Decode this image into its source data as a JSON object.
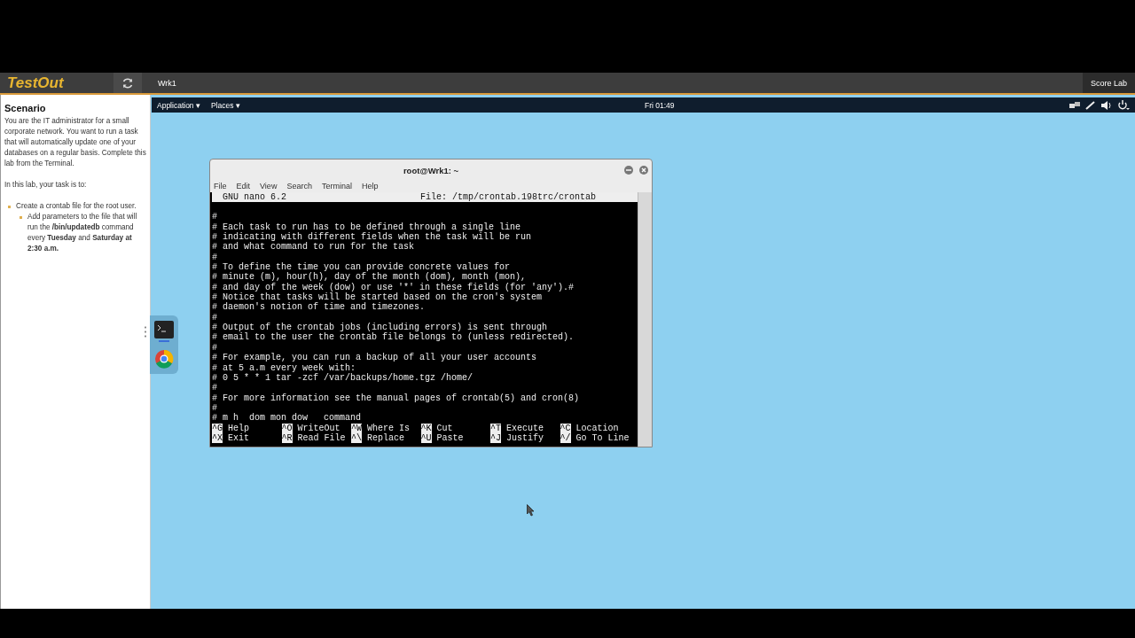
{
  "header": {
    "logo": "TestOut",
    "tab": "Wrk1",
    "score_button": "Score Lab"
  },
  "scenario": {
    "title": "Scenario",
    "paragraphs": [
      "You are the IT administrator for a small corporate network. You want to run a task that will automatically update one of your databases on a regular basis. Complete this lab from the Terminal.",
      "In this lab, your task is to:"
    ],
    "tasks": [
      {
        "text": "Create a crontab file for the root user.",
        "children": [
          {
            "text": "Add parameters to the file that will run the **/bin/updatedb** command every **Tuesday** and **Saturday at 2:30 a.m.**"
          }
        ]
      }
    ]
  },
  "top_panel": {
    "menus": [
      "Application ▾",
      "Places ▾"
    ],
    "clock": "Fri 01:49"
  },
  "terminal": {
    "title": "root@Wrk1: ~",
    "menu": [
      "File",
      "Edit",
      "View",
      "Search",
      "Terminal",
      "Help"
    ],
    "nano_version": "GNU nano 6.2",
    "nano_file": "File: /tmp/crontab.198trc/crontab",
    "lines": [
      "#",
      "# Each task to run has to be defined through a single line",
      "# indicating with different fields when the task will be run",
      "# and what command to run for the task",
      "#",
      "# To define the time you can provide concrete values for",
      "# minute (m), hour(h), day of the month (dom), month (mon),",
      "# and day of the week (dow) or use '*' in these fields (for 'any').#",
      "# Notice that tasks will be started based on the cron's system",
      "# daemon's notion of time and timezones.",
      "#",
      "# Output of the crontab jobs (including errors) is sent through",
      "# email to the user the crontab file belongs to (unless redirected).",
      "#",
      "# For example, you can run a backup of all your user accounts",
      "# at 5 a.m every week with:",
      "# 0 5 * * 1 tar -zcf /var/backups/home.tgz /home/",
      "#",
      "# For more information see the manual pages of crontab(5) and cron(8)",
      "#",
      "# m h  dom mon dow   command"
    ],
    "shortcuts": [
      [
        {
          "key": "^G",
          "label": "Help"
        },
        {
          "key": "^O",
          "label": "WriteOut"
        },
        {
          "key": "^W",
          "label": "Where Is"
        },
        {
          "key": "^K",
          "label": "Cut"
        },
        {
          "key": "^T",
          "label": "Execute"
        },
        {
          "key": "^C",
          "label": "Location"
        }
      ],
      [
        {
          "key": "^X",
          "label": "Exit"
        },
        {
          "key": "^R",
          "label": "Read File"
        },
        {
          "key": "^\\",
          "label": "Replace"
        },
        {
          "key": "^U",
          "label": "Paste"
        },
        {
          "key": "^J",
          "label": "Justify"
        },
        {
          "key": "^/",
          "label": "Go To Line"
        }
      ]
    ]
  }
}
